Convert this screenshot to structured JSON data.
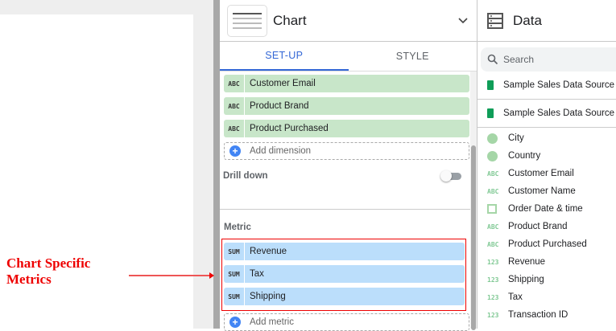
{
  "panel": {
    "title": "Chart",
    "tabs": [
      "SET-UP",
      "STYLE"
    ],
    "dimensions": [
      {
        "type": "ABC",
        "label": "Customer Email"
      },
      {
        "type": "ABC",
        "label": "Product Brand"
      },
      {
        "type": "ABC",
        "label": "Product Purchased"
      }
    ],
    "add_dimension": "Add dimension",
    "drill_down": "Drill down",
    "drill_down_on": false,
    "metric_label": "Metric",
    "metrics": [
      {
        "type": "SUM",
        "label": "Revenue"
      },
      {
        "type": "SUM",
        "label": "Tax"
      },
      {
        "type": "SUM",
        "label": "Shipping"
      }
    ],
    "add_metric": "Add metric"
  },
  "annotation": {
    "line1": "Chart Specific",
    "line2": "Metrics",
    "color": "#e00000"
  },
  "data": {
    "title": "Data",
    "search_placeholder": "Search",
    "sources": [
      "Sample Sales Data Source",
      "Sample Sales Data Source"
    ],
    "fields": [
      {
        "type": "geo",
        "label": "City"
      },
      {
        "type": "geo",
        "label": "Country"
      },
      {
        "type": "ABC",
        "label": "Customer Email"
      },
      {
        "type": "ABC",
        "label": "Customer Name"
      },
      {
        "type": "date",
        "label": "Order Date & time"
      },
      {
        "type": "ABC",
        "label": "Product Brand"
      },
      {
        "type": "ABC",
        "label": "Product Purchased"
      },
      {
        "type": "123",
        "label": "Revenue"
      },
      {
        "type": "123",
        "label": "Shipping"
      },
      {
        "type": "123",
        "label": "Tax"
      },
      {
        "type": "123",
        "label": "Transaction ID"
      }
    ]
  }
}
